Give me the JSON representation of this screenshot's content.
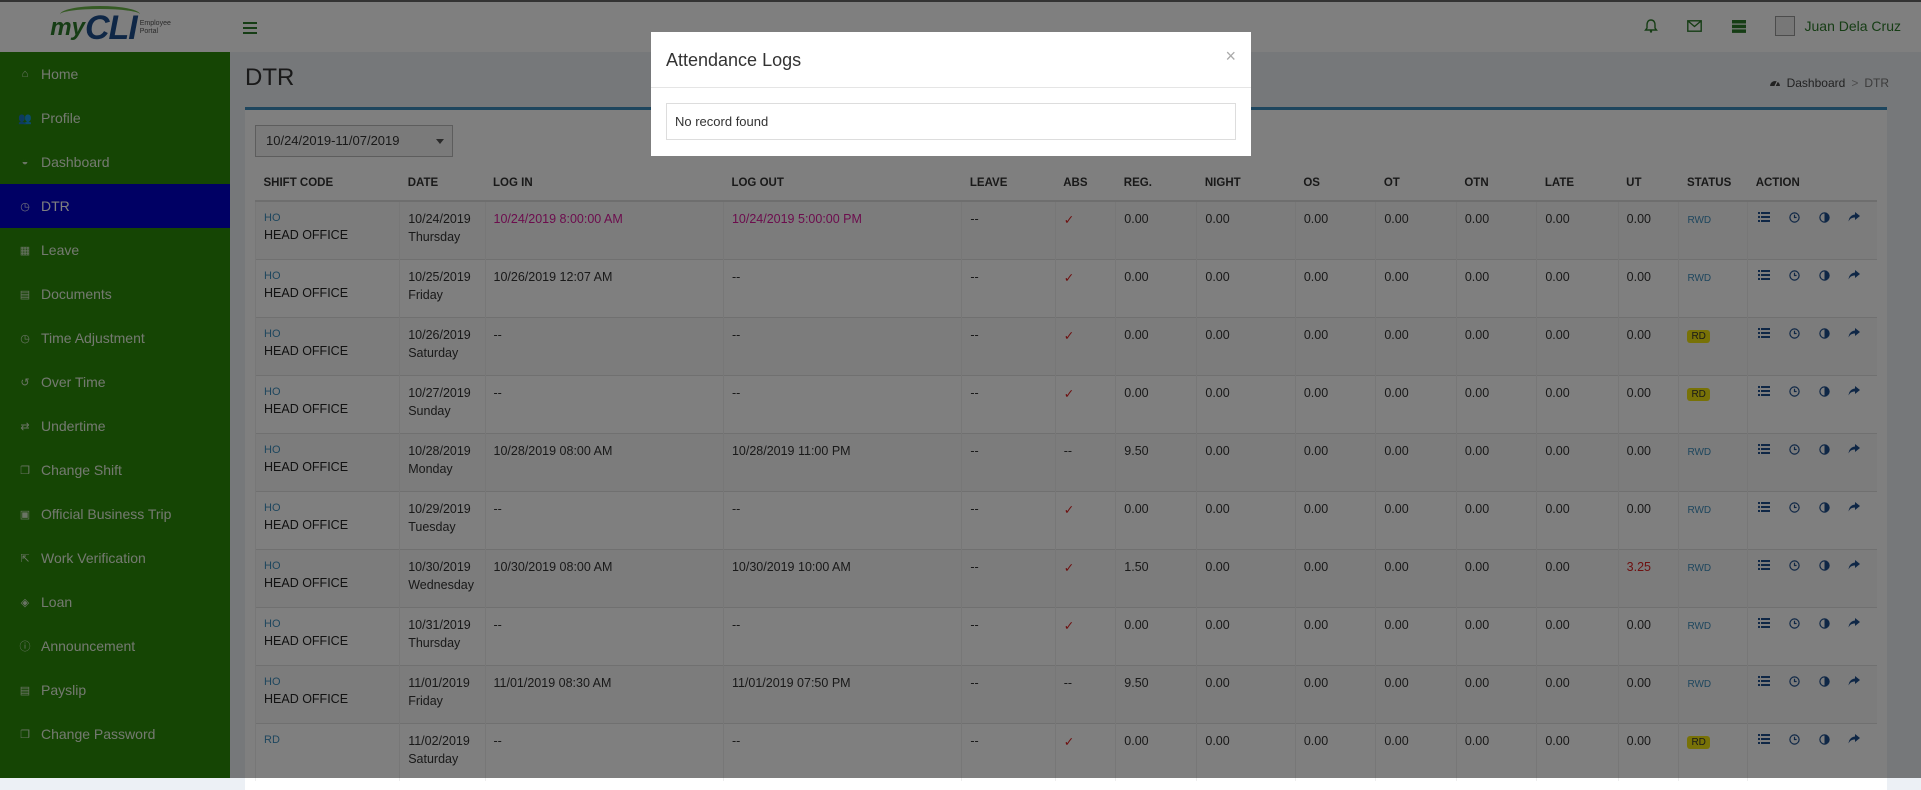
{
  "app": {
    "logo_my": "my",
    "logo_cli": "CLI",
    "logo_tagline": "Employee Portal",
    "user_name": "Juan Dela Cruz"
  },
  "sidebar": {
    "items": [
      {
        "label": "Home",
        "icon": "home-icon"
      },
      {
        "label": "Profile",
        "icon": "users-icon"
      },
      {
        "label": "Dashboard",
        "icon": "dashboard-icon"
      },
      {
        "label": "DTR",
        "icon": "clock-icon",
        "active": true
      },
      {
        "label": "Leave",
        "icon": "calendar-icon"
      },
      {
        "label": "Documents",
        "icon": "document-icon"
      },
      {
        "label": "Time Adjustment",
        "icon": "clock-icon"
      },
      {
        "label": "Over Time",
        "icon": "history-icon"
      },
      {
        "label": "Undertime",
        "icon": "exchange-icon"
      },
      {
        "label": "Change Shift",
        "icon": "copy-icon"
      },
      {
        "label": "Official Business Trip",
        "icon": "briefcase-icon"
      },
      {
        "label": "Work Verification",
        "icon": "external-link-icon"
      },
      {
        "label": "Loan",
        "icon": "tag-icon"
      },
      {
        "label": "Announcement",
        "icon": "info-icon"
      },
      {
        "label": "Payslip",
        "icon": "file-icon"
      },
      {
        "label": "Change Password",
        "icon": "copy-icon"
      }
    ]
  },
  "page": {
    "title": "DTR",
    "breadcrumb_home": "Dashboard",
    "breadcrumb_sep": ">",
    "breadcrumb_current": "DTR",
    "date_range": "10/24/2019-11/07/2019"
  },
  "table": {
    "headers": [
      "SHIFT CODE",
      "DATE",
      "LOG IN",
      "LOG OUT",
      "LEAVE",
      "ABS",
      "REG.",
      "NIGHT",
      "OS",
      "OT",
      "OTN",
      "LATE",
      "UT",
      "STATUS",
      "ACTION"
    ],
    "rows": [
      {
        "code": "HO",
        "shift": "HEAD OFFICE",
        "date": "10/24/2019",
        "day": "Thursday",
        "login": "10/24/2019 8:00:00 AM",
        "logout": "10/24/2019 5:00:00 PM",
        "leave": "--",
        "abs": "✓",
        "reg": "0.00",
        "night": "0.00",
        "os": "0.00",
        "ot": "0.00",
        "otn": "0.00",
        "late": "0.00",
        "ut": "0.00",
        "status": "RWD",
        "highlight": true
      },
      {
        "code": "HO",
        "shift": "HEAD OFFICE",
        "date": "10/25/2019",
        "day": "Friday",
        "login": "10/26/2019 12:07 AM",
        "logout": "--",
        "leave": "--",
        "abs": "✓",
        "reg": "0.00",
        "night": "0.00",
        "os": "0.00",
        "ot": "0.00",
        "otn": "0.00",
        "late": "0.00",
        "ut": "0.00",
        "status": "RWD"
      },
      {
        "code": "HO",
        "shift": "HEAD OFFICE",
        "date": "10/26/2019",
        "day": "Saturday",
        "login": "--",
        "logout": "--",
        "leave": "--",
        "abs": "✓",
        "reg": "0.00",
        "night": "0.00",
        "os": "0.00",
        "ot": "0.00",
        "otn": "0.00",
        "late": "0.00",
        "ut": "0.00",
        "status": "RD"
      },
      {
        "code": "HO",
        "shift": "HEAD OFFICE",
        "date": "10/27/2019",
        "day": "Sunday",
        "login": "--",
        "logout": "--",
        "leave": "--",
        "abs": "✓",
        "reg": "0.00",
        "night": "0.00",
        "os": "0.00",
        "ot": "0.00",
        "otn": "0.00",
        "late": "0.00",
        "ut": "0.00",
        "status": "RD"
      },
      {
        "code": "HO",
        "shift": "HEAD OFFICE",
        "date": "10/28/2019",
        "day": "Monday",
        "login": "10/28/2019 08:00 AM",
        "logout": "10/28/2019 11:00 PM",
        "leave": "--",
        "abs": "--",
        "reg": "9.50",
        "night": "0.00",
        "os": "0.00",
        "ot": "0.00",
        "otn": "0.00",
        "late": "0.00",
        "ut": "0.00",
        "status": "RWD"
      },
      {
        "code": "HO",
        "shift": "HEAD OFFICE",
        "date": "10/29/2019",
        "day": "Tuesday",
        "login": "--",
        "logout": "--",
        "leave": "--",
        "abs": "✓",
        "reg": "0.00",
        "night": "0.00",
        "os": "0.00",
        "ot": "0.00",
        "otn": "0.00",
        "late": "0.00",
        "ut": "0.00",
        "status": "RWD"
      },
      {
        "code": "HO",
        "shift": "HEAD OFFICE",
        "date": "10/30/2019",
        "day": "Wednesday",
        "login": "10/30/2019 08:00 AM",
        "logout": "10/30/2019 10:00 AM",
        "leave": "--",
        "abs": "✓",
        "reg": "1.50",
        "night": "0.00",
        "os": "0.00",
        "ot": "0.00",
        "otn": "0.00",
        "late": "0.00",
        "ut": "3.25",
        "ut_red": true,
        "status": "RWD"
      },
      {
        "code": "HO",
        "shift": "HEAD OFFICE",
        "date": "10/31/2019",
        "day": "Thursday",
        "login": "--",
        "logout": "--",
        "leave": "--",
        "abs": "✓",
        "reg": "0.00",
        "night": "0.00",
        "os": "0.00",
        "ot": "0.00",
        "otn": "0.00",
        "late": "0.00",
        "ut": "0.00",
        "status": "RWD"
      },
      {
        "code": "HO",
        "shift": "HEAD OFFICE",
        "date": "11/01/2019",
        "day": "Friday",
        "login": "11/01/2019 08:30 AM",
        "logout": "11/01/2019 07:50 PM",
        "leave": "--",
        "abs": "--",
        "reg": "9.50",
        "night": "0.00",
        "os": "0.00",
        "ot": "0.00",
        "otn": "0.00",
        "late": "0.00",
        "ut": "0.00",
        "status": "RWD"
      },
      {
        "code": "RD",
        "shift": "",
        "date": "11/02/2019",
        "day": "Saturday",
        "login": "--",
        "logout": "--",
        "leave": "--",
        "abs": "✓",
        "reg": "0.00",
        "night": "0.00",
        "os": "0.00",
        "ot": "0.00",
        "otn": "0.00",
        "late": "0.00",
        "ut": "0.00",
        "status": "RD"
      }
    ]
  },
  "modal": {
    "title": "Attendance Logs",
    "close": "×",
    "message": "No record found"
  },
  "colors": {
    "sidebar_bg": "#2a8a08",
    "sidebar_active": "#0000c8",
    "accent": "#3c8dbc",
    "highlight_pink": "#d81b9b",
    "abs_red": "#dd2222",
    "rd_badge": "#f1e40e"
  }
}
